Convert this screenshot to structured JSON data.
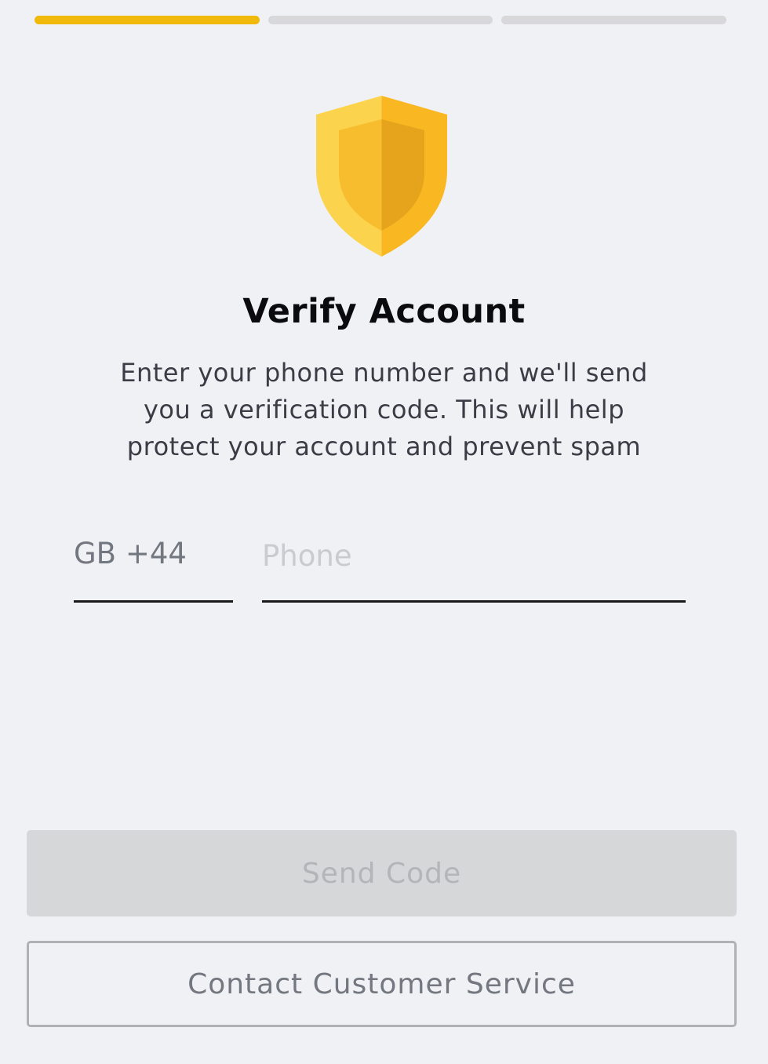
{
  "progress": {
    "steps_total": 3,
    "current_step": 1
  },
  "icon": {
    "name": "shield-icon",
    "colors": {
      "light": "#fcd34d",
      "mid": "#f9bf2c",
      "dark": "#f0b90b",
      "inner_light": "#f6b82e",
      "inner_dark": "#e4a51c"
    }
  },
  "title": "Verify Account",
  "description": "Enter your phone number and we'll send you a verification code. This will help protect your account and prevent spam",
  "form": {
    "country_code": "GB +44",
    "phone_value": "",
    "phone_placeholder": "Phone"
  },
  "buttons": {
    "send_code": "Send Code",
    "contact_service": "Contact Customer Service"
  },
  "colors": {
    "accent": "#f0b90b",
    "background": "#eff1f4",
    "disabled_button": "#d6d7d9"
  }
}
